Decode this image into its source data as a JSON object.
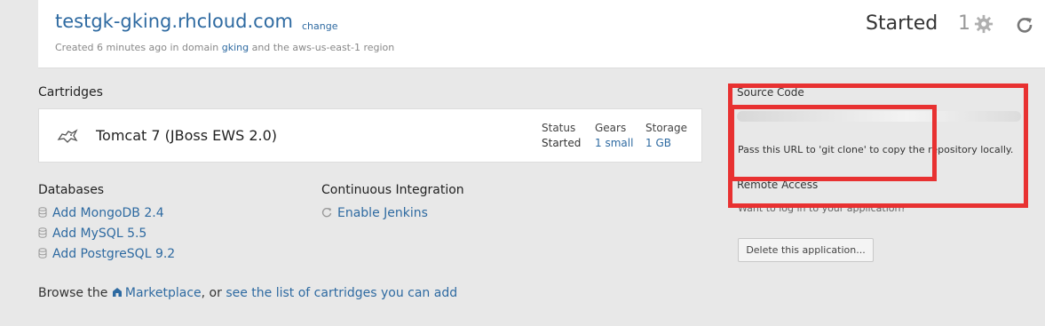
{
  "header": {
    "app_name": "testgk-gking.rhcloud.com",
    "change_label": "change",
    "created_prefix": "Created 6 minutes ago in domain ",
    "domain": "gking",
    "created_suffix": " and the aws-us-east-1 region",
    "status": "Started",
    "gear_count": "1"
  },
  "cartridges": {
    "title": "Cartridges",
    "items": [
      {
        "name": "Tomcat 7 (JBoss EWS 2.0)",
        "status_label": "Status",
        "status_value": "Started",
        "gears_label": "Gears",
        "gears_value": "1 small",
        "storage_label": "Storage",
        "storage_value": "1 GB"
      }
    ]
  },
  "databases": {
    "title": "Databases",
    "items": [
      "Add MongoDB 2.4",
      "Add MySQL 5.5",
      "Add PostgreSQL 9.2"
    ]
  },
  "ci": {
    "title": "Continuous Integration",
    "link": "Enable Jenkins"
  },
  "browse": {
    "prefix": "Browse the ",
    "marketplace": "Marketplace",
    "middle": ", or ",
    "list_link": "see the list of cartridges you can add"
  },
  "source_code": {
    "title": "Source Code",
    "hint": "Pass this URL to 'git clone' to copy the repository locally."
  },
  "remote_access": {
    "title": "Remote Access",
    "hint": "Want to log in to your application?"
  },
  "delete_label": "Delete this application...",
  "colors": {
    "link": "#2e6aa1",
    "annotation": "#e83131",
    "background": "#e8e8e8"
  }
}
